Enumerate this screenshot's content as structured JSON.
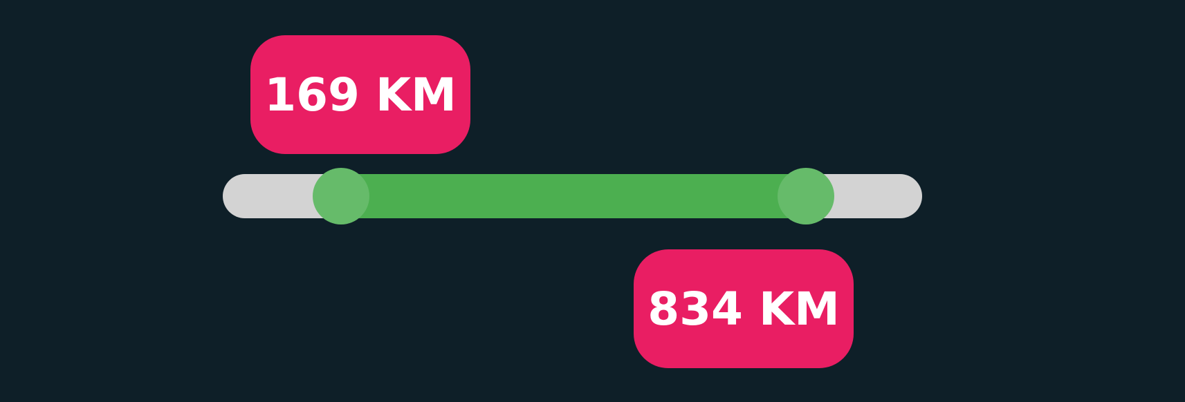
{
  "slider": {
    "min_value": 169,
    "max_value": 834,
    "min_fraction": 0.169,
    "max_fraction": 0.834,
    "unit": "KM",
    "min_label": "169 KM",
    "max_label": "834 KM"
  },
  "colors": {
    "background": "#0e1f28",
    "track": "#d3d3d3",
    "fill": "#4caf50",
    "thumb": "#66bb6a",
    "label_bg": "#e91e63",
    "label_text": "#ffffff"
  }
}
